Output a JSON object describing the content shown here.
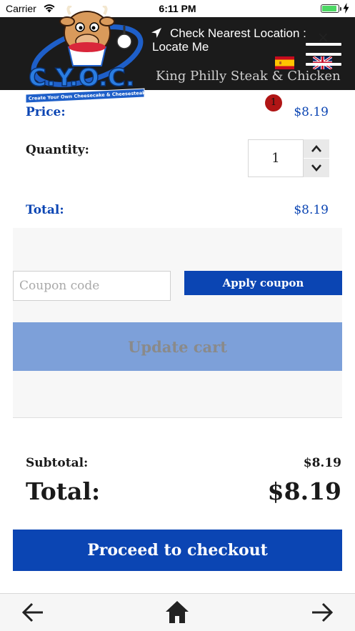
{
  "status_bar": {
    "carrier": "Carrier",
    "time": "6:11 PM",
    "icons": [
      "wifi-icon",
      "battery-icon",
      "charging-bolt-icon"
    ]
  },
  "header": {
    "location_line1": "Check Nearest Location :",
    "location_line2": "Locate Me",
    "logo_text": "C.Y.O.C.",
    "logo_tagline": "Create Your Own Cheesecake & Cheesesteak",
    "background_color": "#1b1b1b",
    "icons": [
      "location-arrow-icon",
      "spain-flag-icon",
      "uk-flag-icon",
      "hamburger-menu-icon"
    ]
  },
  "product": {
    "name": "King Philly Steak & Chicken",
    "close_symbol": "×"
  },
  "cart": {
    "badge_count": "1",
    "price_label": "Price:",
    "price_value": "$8.19",
    "quantity_label": "Quantity:",
    "quantity_value": "1",
    "total_label": "Total:",
    "total_value": "$8.19"
  },
  "coupon": {
    "placeholder": "Coupon code",
    "apply_label": "Apply coupon",
    "update_label": "Update cart"
  },
  "totals": {
    "subtotal_label": "Subtotal:",
    "subtotal_value": "$8.19",
    "total_label": "Total:",
    "total_value": "$8.19"
  },
  "checkout": {
    "label": "Proceed to checkout"
  },
  "bottom_nav": {
    "icons": [
      "back-arrow-icon",
      "home-icon",
      "forward-arrow-icon"
    ]
  },
  "colors": {
    "accent": "#0b45b3",
    "update_button": "#7da0d9",
    "badge": "#b01515",
    "header": "#1b1b1b"
  }
}
